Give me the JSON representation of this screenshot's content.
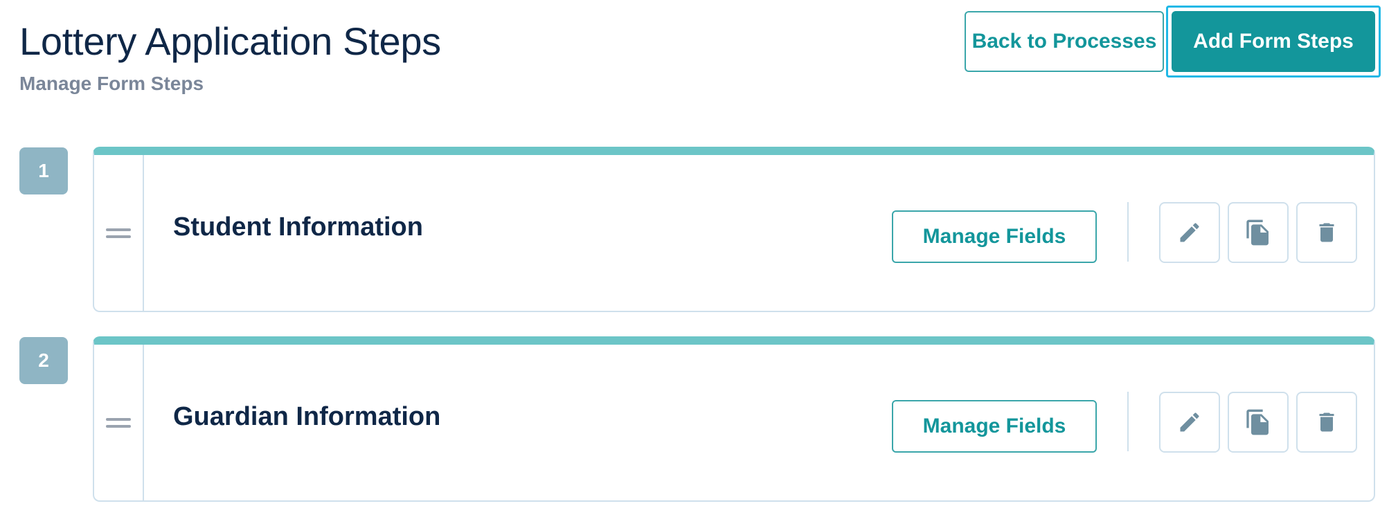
{
  "header": {
    "title": "Lottery Application Steps",
    "subtitle": "Manage Form Steps",
    "back_button": "Back to Processes",
    "add_button": "Add Form Steps"
  },
  "steps": [
    {
      "number": "1",
      "title": "Student Information",
      "manage_label": "Manage Fields",
      "icons": [
        "drag-handle-icon",
        "pencil-icon",
        "copy-icon",
        "trash-icon"
      ]
    },
    {
      "number": "2",
      "title": "Guardian Information",
      "manage_label": "Manage Fields",
      "icons": [
        "drag-handle-icon",
        "pencil-icon",
        "copy-icon",
        "trash-icon"
      ]
    }
  ],
  "colors": {
    "primary": "#13969b",
    "card_accent": "#6cc5c7",
    "step_badge": "#8fb5c4",
    "icon": "#6f8fa0",
    "focus_ring": "#1fb8e6",
    "title": "#0f2747",
    "subtitle": "#7a8699"
  }
}
